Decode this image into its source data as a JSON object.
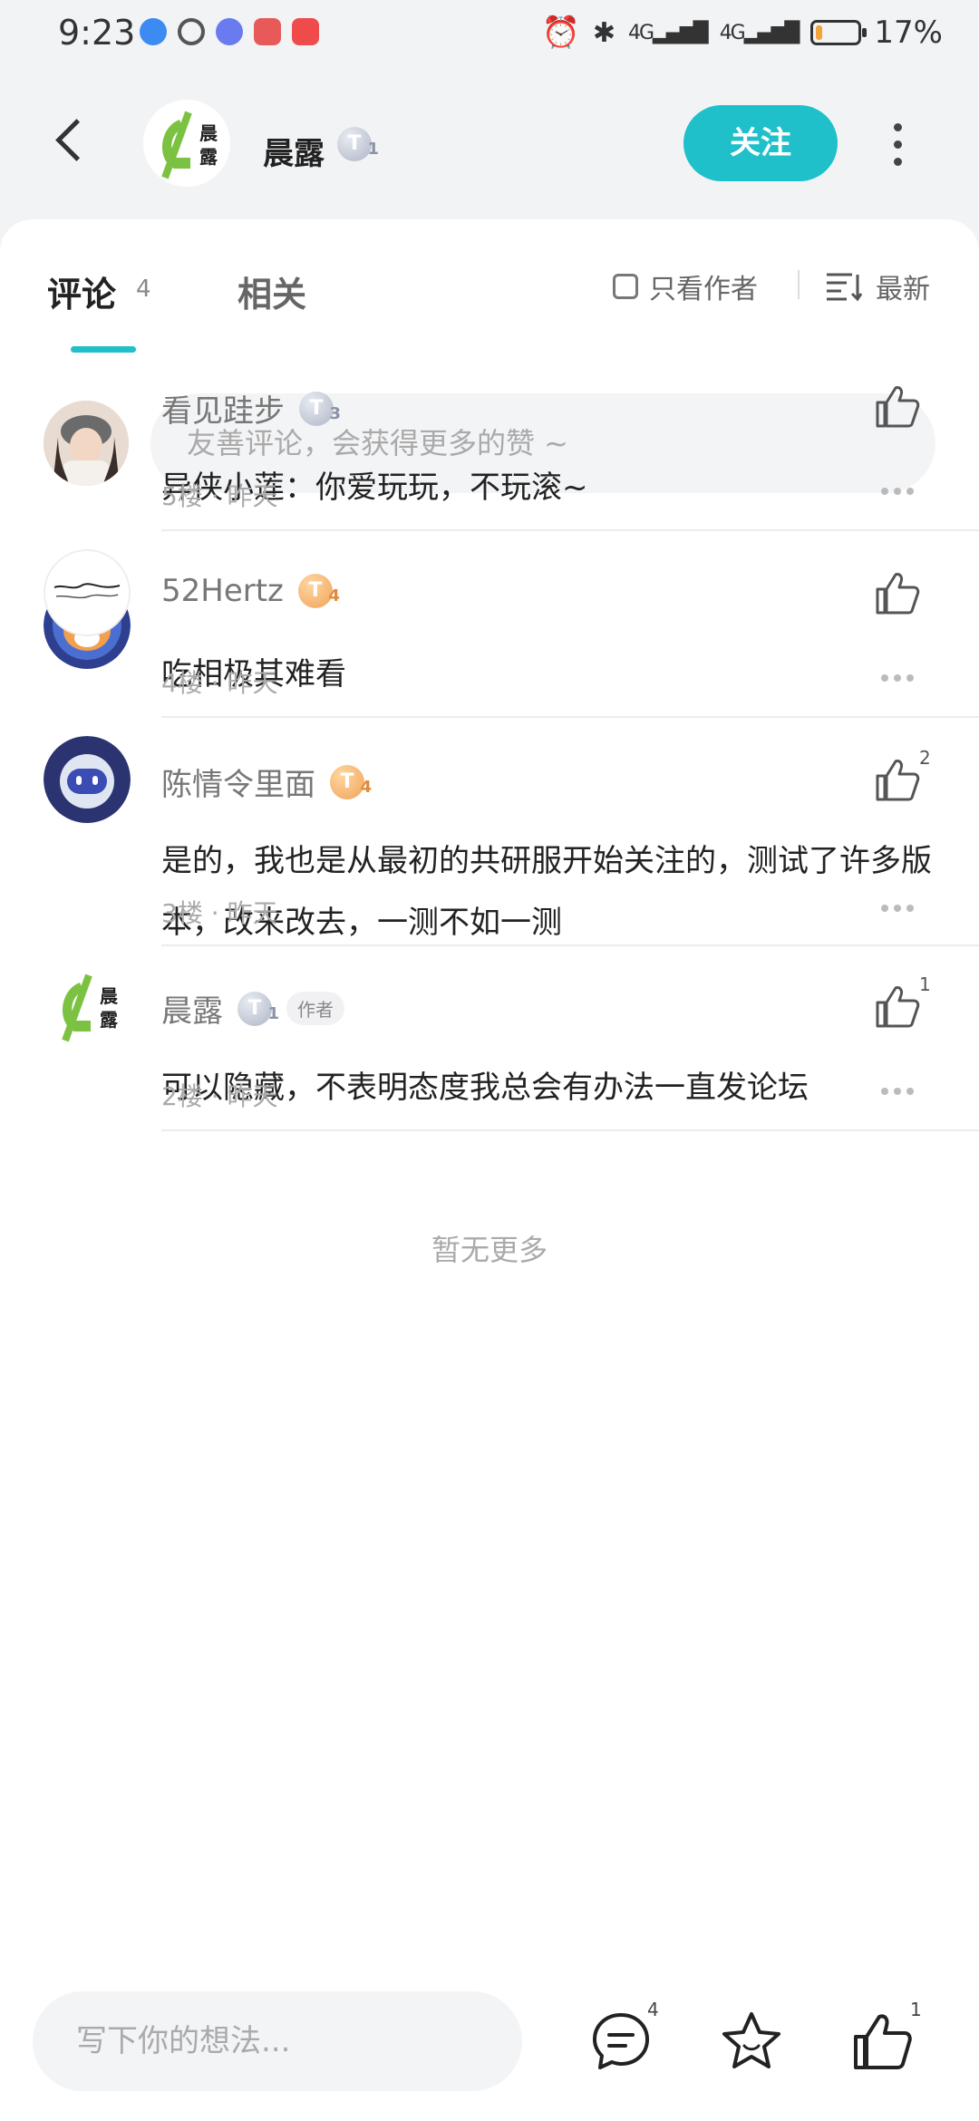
{
  "status_bar": {
    "time": "9:23",
    "signal1": "4G",
    "signal2": "4G",
    "battery": "17%",
    "battery_level": 0.17
  },
  "header": {
    "author_name": "晨露",
    "author_level": "T",
    "author_level_num": "1",
    "follow_label": "关注"
  },
  "tabs": {
    "comments_label": "评论",
    "comments_count": "4",
    "related_label": "相关",
    "only_author_label": "只看作者",
    "sort_label": "最新"
  },
  "composer": {
    "placeholder": "友善评论，会获得更多的赞 ~"
  },
  "comments": [
    {
      "name": "看见跬步",
      "level": "T",
      "level_num": "3",
      "level_color": "silver",
      "text": "异侠小莲：你爱玩玩，不玩滚~",
      "floor": "5楼",
      "time": "昨天",
      "likes": ""
    },
    {
      "name": "52Hertz",
      "level": "T",
      "level_num": "4",
      "level_color": "gold",
      "text": "吃相极其难看",
      "floor": "4楼",
      "time": "昨天",
      "likes": ""
    },
    {
      "name": "陈情令里面",
      "level": "T",
      "level_num": "4",
      "level_color": "gold",
      "text": "是的，我也是从最初的共研服开始关注的，测试了许多版本，改来改去，一测不如一测",
      "floor": "3楼",
      "time": "昨天",
      "likes": "2"
    },
    {
      "name": "晨露",
      "level": "T",
      "level_num": "1",
      "level_color": "silver",
      "author_tag": "作者",
      "text": "可以隐藏，不表明态度我总会有办法一直发论坛",
      "floor": "2楼",
      "time": "昨天",
      "likes": "1"
    }
  ],
  "no_more": "暂无更多",
  "bottom_bar": {
    "placeholder": "写下你的想法...",
    "comment_count": "4",
    "like_count": "1"
  },
  "colors": {
    "accent": "#1fc0c9",
    "logo_green": "#7cc242"
  }
}
